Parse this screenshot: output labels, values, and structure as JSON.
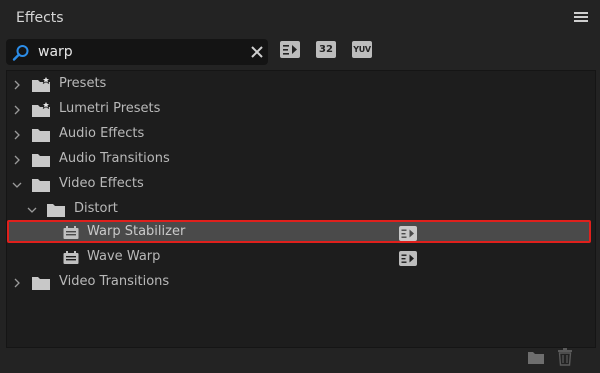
{
  "panel": {
    "title": "Effects"
  },
  "search": {
    "value": "warp",
    "placeholder": ""
  },
  "filters": [
    {
      "name": "accelerated-effects-filter",
      "icon": "accelerated-effects-icon"
    },
    {
      "name": "32-bit-filter",
      "label": "32",
      "icon": "32-bit-icon"
    },
    {
      "name": "yuv-filter",
      "label": "YUV",
      "icon": "yuv-icon"
    }
  ],
  "tree": {
    "items": [
      {
        "label": "Presets",
        "icon": "folder-star-icon",
        "expanded": false
      },
      {
        "label": "Lumetri Presets",
        "icon": "folder-star-icon",
        "expanded": false
      },
      {
        "label": "Audio Effects",
        "icon": "folder-icon",
        "expanded": false
      },
      {
        "label": "Audio Transitions",
        "icon": "folder-icon",
        "expanded": false
      },
      {
        "label": "Video Effects",
        "icon": "folder-icon",
        "expanded": true
      },
      {
        "label": "Distort",
        "icon": "folder-icon",
        "expanded": true
      },
      {
        "label": "Warp Stabilizer",
        "icon": "effect-icon",
        "accelerated": true,
        "selected": true
      },
      {
        "label": "Wave Warp",
        "icon": "effect-icon",
        "accelerated": true,
        "selected": false
      },
      {
        "label": "Video Transitions",
        "icon": "folder-icon",
        "expanded": false
      }
    ]
  },
  "footer": {
    "new_bin_icon": "new-folder-icon",
    "delete_icon": "trash-icon"
  },
  "colors": {
    "background": "#232323",
    "tree_bg": "#1d1d1d",
    "highlight_border": "#e0201c",
    "selected_row": "#4a4a4a"
  }
}
